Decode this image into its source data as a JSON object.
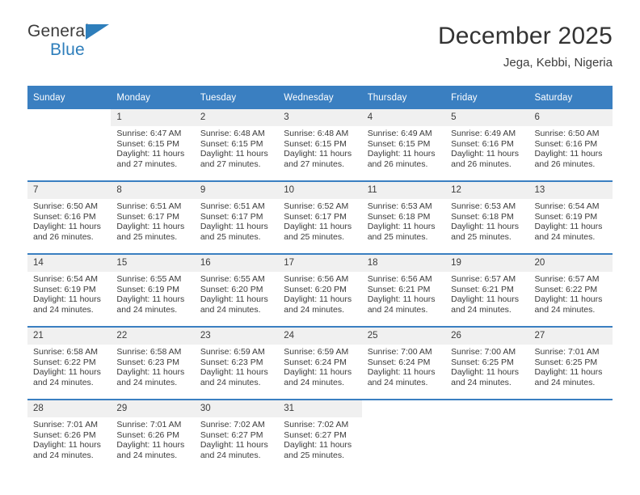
{
  "brand": {
    "name_top": "General",
    "name_bottom": "Blue",
    "triangle_icon": "brand-triangle-icon",
    "accent_color": "#2e7ebb"
  },
  "header": {
    "title": "December 2025",
    "subtitle": "Jega, Kebbi, Nigeria"
  },
  "calendar": {
    "header_color": "#3a7fc1",
    "daynum_bg": "#f0f0f0",
    "weekdays": [
      "Sunday",
      "Monday",
      "Tuesday",
      "Wednesday",
      "Thursday",
      "Friday",
      "Saturday"
    ],
    "weeks": [
      [
        {
          "day": "",
          "sunrise": "",
          "sunset": "",
          "daylight1": "",
          "daylight2": ""
        },
        {
          "day": "1",
          "sunrise": "Sunrise: 6:47 AM",
          "sunset": "Sunset: 6:15 PM",
          "daylight1": "Daylight: 11 hours",
          "daylight2": "and 27 minutes."
        },
        {
          "day": "2",
          "sunrise": "Sunrise: 6:48 AM",
          "sunset": "Sunset: 6:15 PM",
          "daylight1": "Daylight: 11 hours",
          "daylight2": "and 27 minutes."
        },
        {
          "day": "3",
          "sunrise": "Sunrise: 6:48 AM",
          "sunset": "Sunset: 6:15 PM",
          "daylight1": "Daylight: 11 hours",
          "daylight2": "and 27 minutes."
        },
        {
          "day": "4",
          "sunrise": "Sunrise: 6:49 AM",
          "sunset": "Sunset: 6:15 PM",
          "daylight1": "Daylight: 11 hours",
          "daylight2": "and 26 minutes."
        },
        {
          "day": "5",
          "sunrise": "Sunrise: 6:49 AM",
          "sunset": "Sunset: 6:16 PM",
          "daylight1": "Daylight: 11 hours",
          "daylight2": "and 26 minutes."
        },
        {
          "day": "6",
          "sunrise": "Sunrise: 6:50 AM",
          "sunset": "Sunset: 6:16 PM",
          "daylight1": "Daylight: 11 hours",
          "daylight2": "and 26 minutes."
        }
      ],
      [
        {
          "day": "7",
          "sunrise": "Sunrise: 6:50 AM",
          "sunset": "Sunset: 6:16 PM",
          "daylight1": "Daylight: 11 hours",
          "daylight2": "and 26 minutes."
        },
        {
          "day": "8",
          "sunrise": "Sunrise: 6:51 AM",
          "sunset": "Sunset: 6:17 PM",
          "daylight1": "Daylight: 11 hours",
          "daylight2": "and 25 minutes."
        },
        {
          "day": "9",
          "sunrise": "Sunrise: 6:51 AM",
          "sunset": "Sunset: 6:17 PM",
          "daylight1": "Daylight: 11 hours",
          "daylight2": "and 25 minutes."
        },
        {
          "day": "10",
          "sunrise": "Sunrise: 6:52 AM",
          "sunset": "Sunset: 6:17 PM",
          "daylight1": "Daylight: 11 hours",
          "daylight2": "and 25 minutes."
        },
        {
          "day": "11",
          "sunrise": "Sunrise: 6:53 AM",
          "sunset": "Sunset: 6:18 PM",
          "daylight1": "Daylight: 11 hours",
          "daylight2": "and 25 minutes."
        },
        {
          "day": "12",
          "sunrise": "Sunrise: 6:53 AM",
          "sunset": "Sunset: 6:18 PM",
          "daylight1": "Daylight: 11 hours",
          "daylight2": "and 25 minutes."
        },
        {
          "day": "13",
          "sunrise": "Sunrise: 6:54 AM",
          "sunset": "Sunset: 6:19 PM",
          "daylight1": "Daylight: 11 hours",
          "daylight2": "and 24 minutes."
        }
      ],
      [
        {
          "day": "14",
          "sunrise": "Sunrise: 6:54 AM",
          "sunset": "Sunset: 6:19 PM",
          "daylight1": "Daylight: 11 hours",
          "daylight2": "and 24 minutes."
        },
        {
          "day": "15",
          "sunrise": "Sunrise: 6:55 AM",
          "sunset": "Sunset: 6:19 PM",
          "daylight1": "Daylight: 11 hours",
          "daylight2": "and 24 minutes."
        },
        {
          "day": "16",
          "sunrise": "Sunrise: 6:55 AM",
          "sunset": "Sunset: 6:20 PM",
          "daylight1": "Daylight: 11 hours",
          "daylight2": "and 24 minutes."
        },
        {
          "day": "17",
          "sunrise": "Sunrise: 6:56 AM",
          "sunset": "Sunset: 6:20 PM",
          "daylight1": "Daylight: 11 hours",
          "daylight2": "and 24 minutes."
        },
        {
          "day": "18",
          "sunrise": "Sunrise: 6:56 AM",
          "sunset": "Sunset: 6:21 PM",
          "daylight1": "Daylight: 11 hours",
          "daylight2": "and 24 minutes."
        },
        {
          "day": "19",
          "sunrise": "Sunrise: 6:57 AM",
          "sunset": "Sunset: 6:21 PM",
          "daylight1": "Daylight: 11 hours",
          "daylight2": "and 24 minutes."
        },
        {
          "day": "20",
          "sunrise": "Sunrise: 6:57 AM",
          "sunset": "Sunset: 6:22 PM",
          "daylight1": "Daylight: 11 hours",
          "daylight2": "and 24 minutes."
        }
      ],
      [
        {
          "day": "21",
          "sunrise": "Sunrise: 6:58 AM",
          "sunset": "Sunset: 6:22 PM",
          "daylight1": "Daylight: 11 hours",
          "daylight2": "and 24 minutes."
        },
        {
          "day": "22",
          "sunrise": "Sunrise: 6:58 AM",
          "sunset": "Sunset: 6:23 PM",
          "daylight1": "Daylight: 11 hours",
          "daylight2": "and 24 minutes."
        },
        {
          "day": "23",
          "sunrise": "Sunrise: 6:59 AM",
          "sunset": "Sunset: 6:23 PM",
          "daylight1": "Daylight: 11 hours",
          "daylight2": "and 24 minutes."
        },
        {
          "day": "24",
          "sunrise": "Sunrise: 6:59 AM",
          "sunset": "Sunset: 6:24 PM",
          "daylight1": "Daylight: 11 hours",
          "daylight2": "and 24 minutes."
        },
        {
          "day": "25",
          "sunrise": "Sunrise: 7:00 AM",
          "sunset": "Sunset: 6:24 PM",
          "daylight1": "Daylight: 11 hours",
          "daylight2": "and 24 minutes."
        },
        {
          "day": "26",
          "sunrise": "Sunrise: 7:00 AM",
          "sunset": "Sunset: 6:25 PM",
          "daylight1": "Daylight: 11 hours",
          "daylight2": "and 24 minutes."
        },
        {
          "day": "27",
          "sunrise": "Sunrise: 7:01 AM",
          "sunset": "Sunset: 6:25 PM",
          "daylight1": "Daylight: 11 hours",
          "daylight2": "and 24 minutes."
        }
      ],
      [
        {
          "day": "28",
          "sunrise": "Sunrise: 7:01 AM",
          "sunset": "Sunset: 6:26 PM",
          "daylight1": "Daylight: 11 hours",
          "daylight2": "and 24 minutes."
        },
        {
          "day": "29",
          "sunrise": "Sunrise: 7:01 AM",
          "sunset": "Sunset: 6:26 PM",
          "daylight1": "Daylight: 11 hours",
          "daylight2": "and 24 minutes."
        },
        {
          "day": "30",
          "sunrise": "Sunrise: 7:02 AM",
          "sunset": "Sunset: 6:27 PM",
          "daylight1": "Daylight: 11 hours",
          "daylight2": "and 24 minutes."
        },
        {
          "day": "31",
          "sunrise": "Sunrise: 7:02 AM",
          "sunset": "Sunset: 6:27 PM",
          "daylight1": "Daylight: 11 hours",
          "daylight2": "and 25 minutes."
        },
        {
          "day": "",
          "sunrise": "",
          "sunset": "",
          "daylight1": "",
          "daylight2": ""
        },
        {
          "day": "",
          "sunrise": "",
          "sunset": "",
          "daylight1": "",
          "daylight2": ""
        },
        {
          "day": "",
          "sunrise": "",
          "sunset": "",
          "daylight1": "",
          "daylight2": ""
        }
      ]
    ]
  }
}
